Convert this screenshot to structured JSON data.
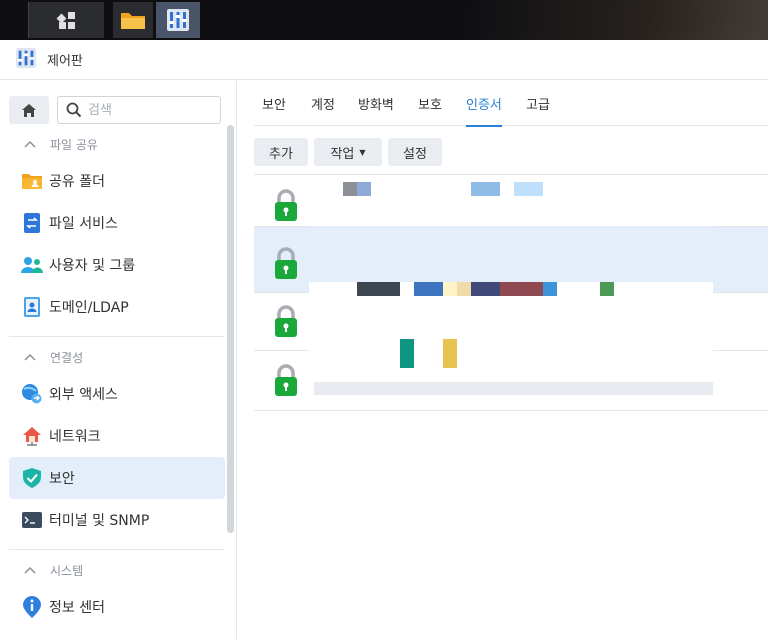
{
  "window": {
    "title": "제어판"
  },
  "colors": {
    "accent": "#2b7fd4",
    "lock_green": "#1aa83a",
    "selected_bg": "#e3eefa"
  },
  "sidebar": {
    "search_placeholder": "검색",
    "sections": [
      {
        "label": "파일 공유",
        "items": [
          {
            "label": "공유 폴더",
            "icon": "shared-folder-icon"
          },
          {
            "label": "파일 서비스",
            "icon": "file-services-icon"
          },
          {
            "label": "사용자 및 그룹",
            "icon": "users-groups-icon"
          },
          {
            "label": "도메인/LDAP",
            "icon": "domain-ldap-icon"
          }
        ]
      },
      {
        "label": "연결성",
        "items": [
          {
            "label": "외부 액세스",
            "icon": "external-access-icon"
          },
          {
            "label": "네트워크",
            "icon": "network-icon"
          },
          {
            "label": "보안",
            "icon": "security-shield-icon",
            "active": true
          },
          {
            "label": "터미널 및 SNMP",
            "icon": "terminal-icon"
          }
        ]
      },
      {
        "label": "시스템",
        "items": [
          {
            "label": "정보 센터",
            "icon": "info-center-icon"
          }
        ]
      }
    ]
  },
  "tabs": [
    {
      "label": "보안"
    },
    {
      "label": "계정"
    },
    {
      "label": "방화벽"
    },
    {
      "label": "보호"
    },
    {
      "label": "인증서",
      "active": true
    },
    {
      "label": "고급"
    }
  ],
  "toolbar": {
    "add": "추가",
    "action": "작업",
    "settings": "설정"
  }
}
